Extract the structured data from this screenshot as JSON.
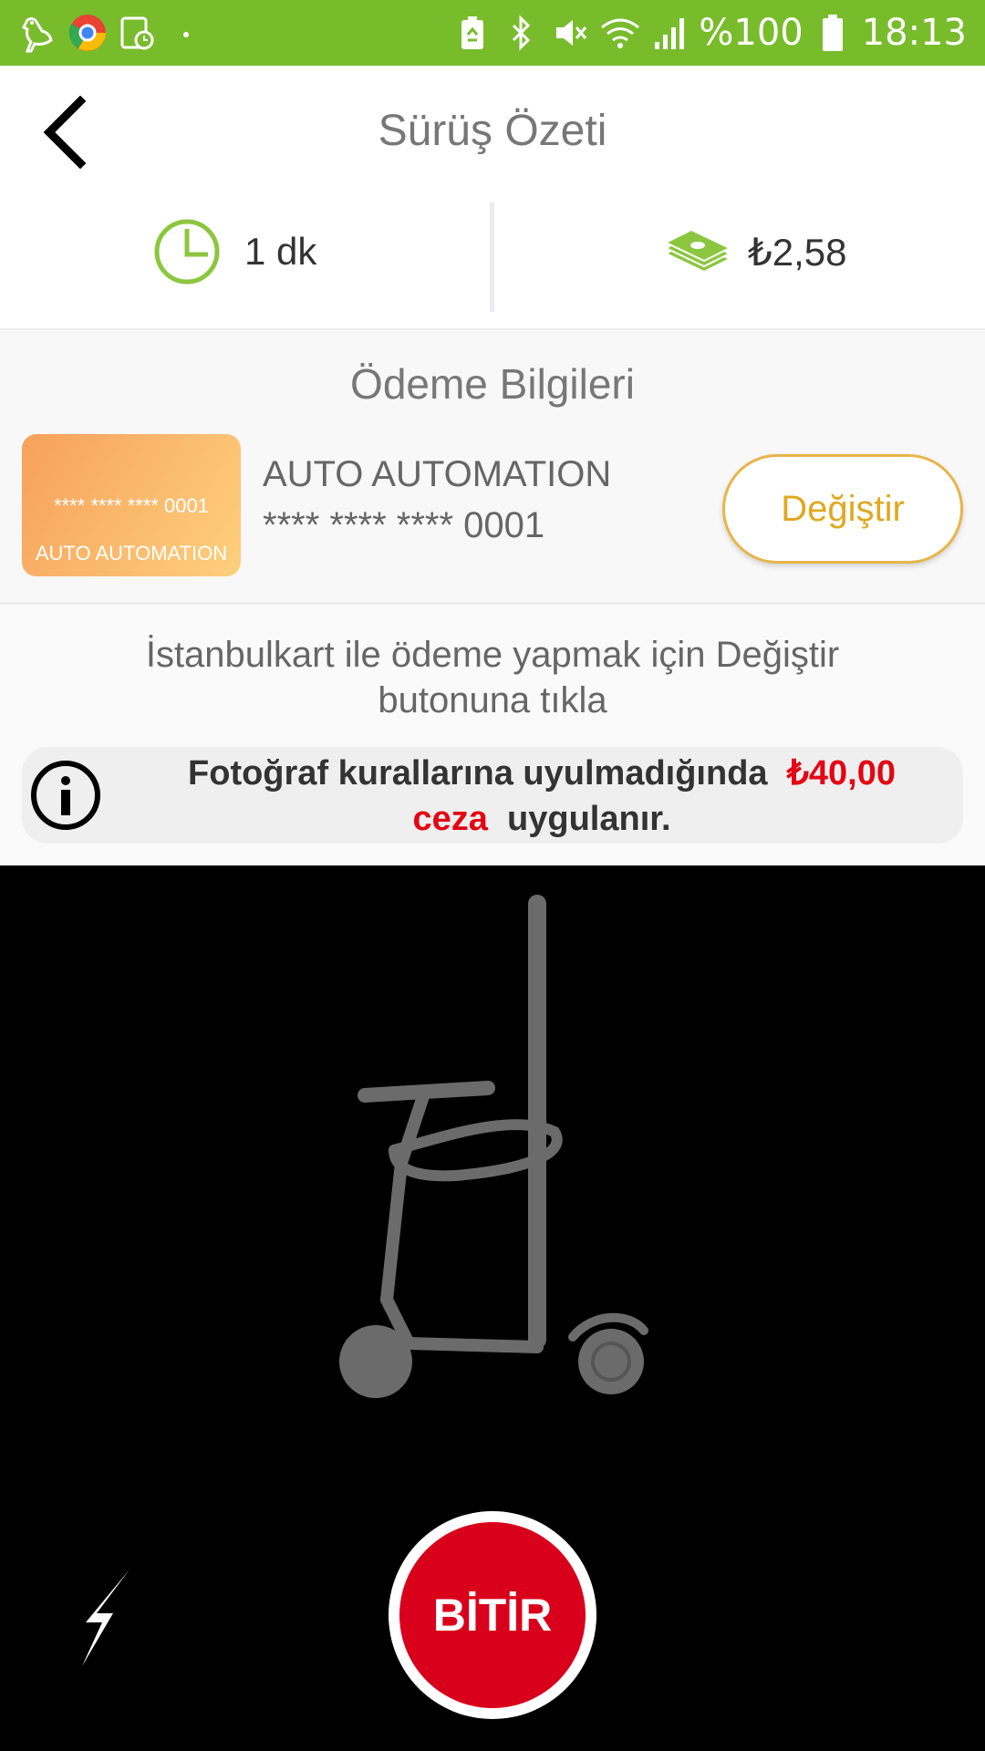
{
  "status_bar": {
    "battery_percent": "%100",
    "time": "18:13",
    "left_icons": [
      "bird-app-icon",
      "chrome-app-icon",
      "tablet-clock-icon",
      "dot-icon"
    ],
    "right_icons": [
      "battery-saver-icon",
      "bluetooth-icon",
      "mute-icon",
      "wifi-icon",
      "signal-icon",
      "battery-icon"
    ]
  },
  "header": {
    "title": "Sürüş Özeti",
    "back_icon": "back-arrow-icon"
  },
  "summary": {
    "duration": "1 dk",
    "cost": "₺2,58",
    "duration_icon": "clock-icon",
    "cost_icon": "money-stack-icon"
  },
  "payment": {
    "title": "Ödeme Bilgileri",
    "card_number_visual": "**** **** **** 0001",
    "card_name_visual": "AUTO AUTOMATION",
    "card_holder": "AUTO AUTOMATION",
    "card_number": "**** **** **** 0001",
    "change_label": "Değiştir"
  },
  "info": {
    "hint_text": "İstanbulkart ile ödeme yapmak için Değiştir butonuna tıkla",
    "warning_prefix": "Fotoğraf kurallarına uyulmadığında",
    "warning_amount": "₺40,00",
    "warning_penalty": "ceza",
    "warning_suffix": "uygulanır.",
    "warning_icon": "info-icon"
  },
  "camera": {
    "overlay_icon": "scooter-silhouette-icon",
    "flash_icon": "flash-icon",
    "finish_label": "BİTİR"
  },
  "colors": {
    "status_bar": "#78bc2c",
    "accent_green": "#8cc63f",
    "change_button_border": "#e8b54a",
    "finish_button": "#d9001b",
    "warning_red": "#e30613"
  }
}
